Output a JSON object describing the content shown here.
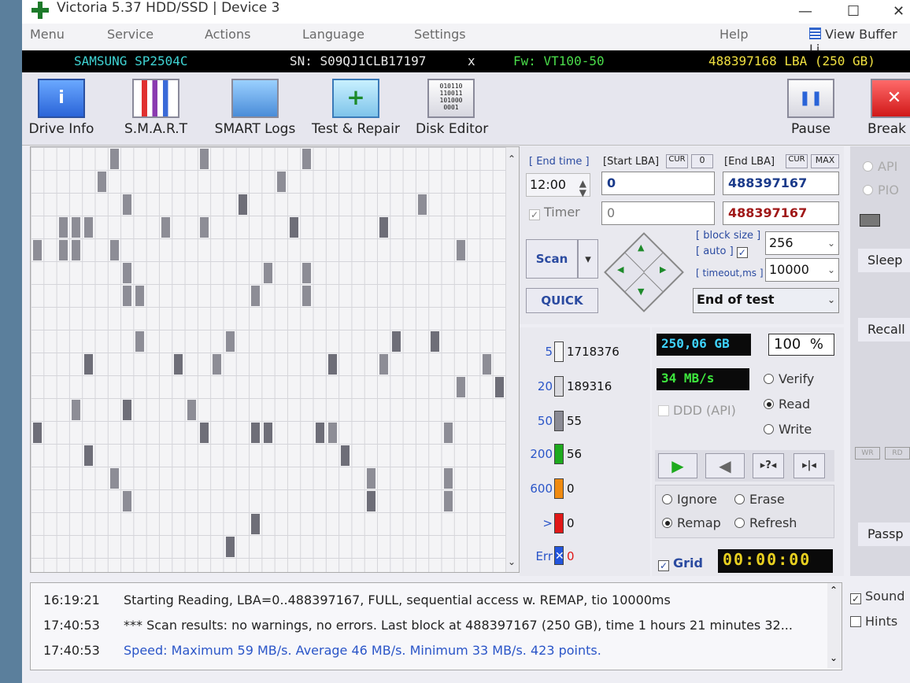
{
  "window": {
    "title": "Victoria 5.37 HDD/SSD | Device 3",
    "minimize": "—",
    "maximize": "☐",
    "close": "✕"
  },
  "menu": [
    "Menu",
    "Service",
    "Actions",
    "Language",
    "Settings",
    "Help"
  ],
  "view_buffer": "View Buffer Li",
  "info": {
    "model": "SAMSUNG SP2504C",
    "serial": "SN: S09QJ1CLB17197",
    "x": "x",
    "firmware": "Fw: VT100-50",
    "capacity": "488397168 LBA (250 GB)"
  },
  "toolbar": {
    "drive_info": "Drive Info",
    "smart": "S.M.A.R.T",
    "smart_logs": "SMART Logs",
    "test_repair": "Test & Repair",
    "disk_editor": "Disk Editor",
    "disk_editor_bits": "010110\n110011\n101000\n0001",
    "pause": "Pause",
    "break": "Break A"
  },
  "test": {
    "end_time_label": "[ End time ]",
    "end_time_value": "12:00",
    "timer_label": "Timer",
    "start_lba_label": "[Start LBA]",
    "cur_label": "CUR",
    "zero_label": "0",
    "start_lba_value": "0",
    "start_lba_value2": "0",
    "end_lba_label": "[End LBA]",
    "max_label": "MAX",
    "end_lba_value": "488397167",
    "end_lba_value2": "488397167",
    "block_size_label": "[ block size ]",
    "block_size_value": "256",
    "auto_label": "[ auto ]",
    "timeout_label": "[ timeout,ms ]",
    "timeout_value": "10000",
    "scan_button": "Scan",
    "quick_button": "QUICK",
    "end_action": "End of test"
  },
  "stats": [
    {
      "threshold": "5",
      "count": "1718376",
      "color": "#f5f5f5"
    },
    {
      "threshold": "20",
      "count": "189316",
      "color": "#d9d9de"
    },
    {
      "threshold": "50",
      "count": "55",
      "color": "#8a8a94"
    },
    {
      "threshold": "200",
      "count": "56",
      "color": "#1eaa1e"
    },
    {
      "threshold": "600",
      "count": "0",
      "color": "#f08a10"
    },
    {
      "threshold": ">",
      "count": "0",
      "color": "#e01818"
    },
    {
      "threshold": "Err",
      "count": "0",
      "color": "#2255dd"
    }
  ],
  "progress": {
    "size": "250,06 GB",
    "percent": "100",
    "percent_sign": "%",
    "speed": "34 MB/s",
    "ddd_label": "DDD (API)",
    "timer_display": "00:00:00",
    "grid_label": "Grid"
  },
  "modes": {
    "verify": "Verify",
    "read": "Read",
    "write": "Write",
    "selected": "read"
  },
  "actions": {
    "ignore": "Ignore",
    "erase": "Erase",
    "remap": "Remap",
    "refresh": "Refresh",
    "selected": "remap"
  },
  "right": {
    "api": "API",
    "pio": "PIO",
    "sleep": "Sleep",
    "recall": "Recall",
    "wr": "WR",
    "rd": "RD",
    "passp": "Passp",
    "sound": "Sound",
    "hints": "Hints"
  },
  "log": [
    {
      "time": "16:19:21",
      "msg": "Starting Reading, LBA=0..488397167, FULL, sequential access w. REMAP, tio 10000ms",
      "color": "#222222"
    },
    {
      "time": "17:40:53",
      "msg": "*** Scan results: no warnings, no errors. Last block at 488397167 (250 GB), time 1 hours 21 minutes 32...",
      "color": "#222222"
    },
    {
      "time": "17:40:53",
      "msg": "Speed: Maximum 59 MB/s. Average 46 MB/s. Minimum 33 MB/s. 423 points.",
      "color": "#2a55c8"
    }
  ]
}
